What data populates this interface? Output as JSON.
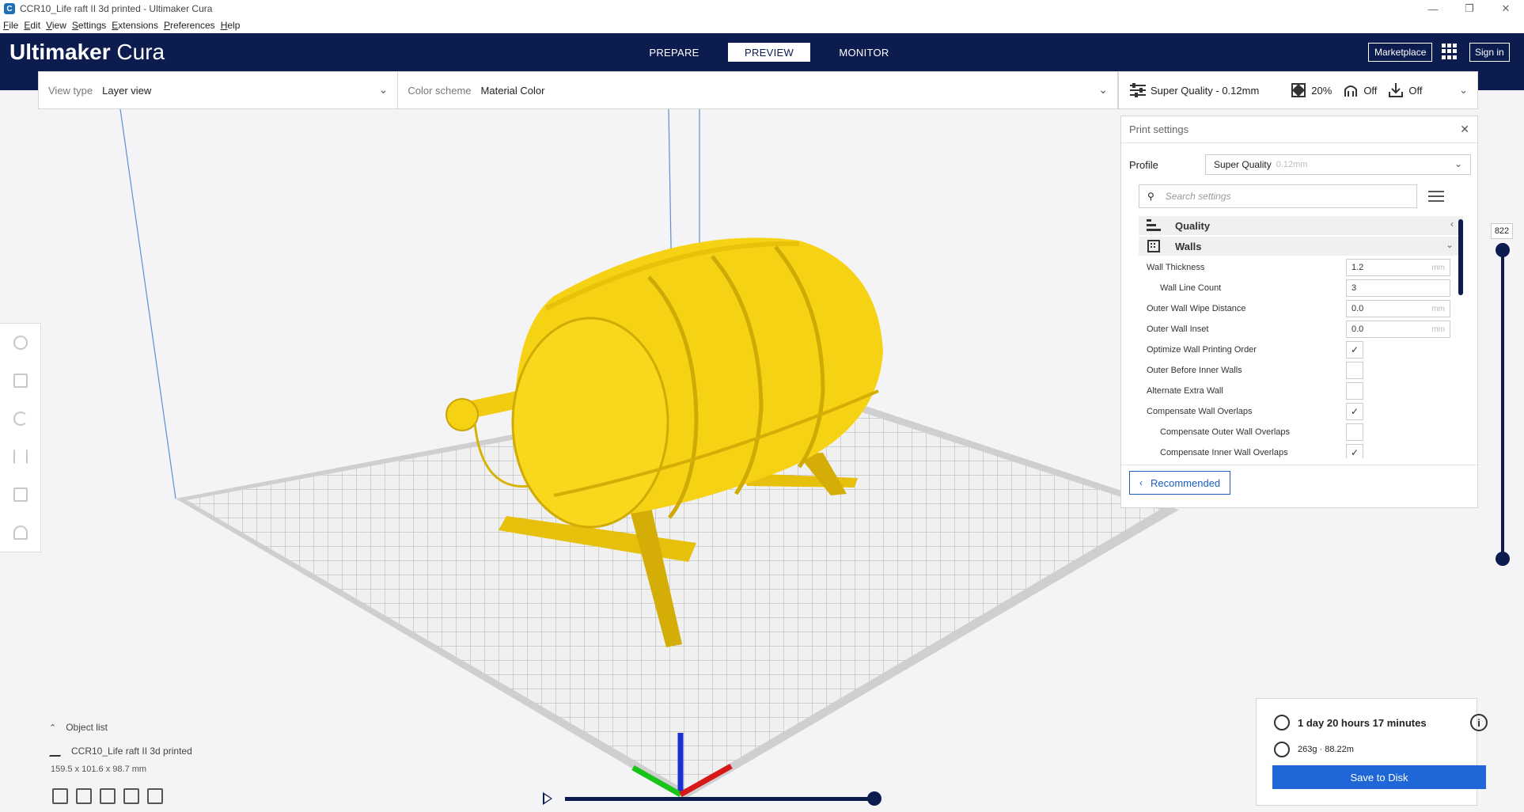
{
  "window": {
    "title": "CCR10_Life raft II 3d printed - Ultimaker Cura",
    "app_icon": "C"
  },
  "menu": [
    "File",
    "Edit",
    "View",
    "Settings",
    "Extensions",
    "Preferences",
    "Help"
  ],
  "header": {
    "logo_bold": "Ultimaker",
    "logo_light": " Cura",
    "tabs": [
      {
        "label": "PREPARE",
        "active": false
      },
      {
        "label": "PREVIEW",
        "active": true
      },
      {
        "label": "MONITOR",
        "active": false
      }
    ],
    "marketplace": "Marketplace",
    "sign_in": "Sign in"
  },
  "viewbar": {
    "view_type_label": "View type",
    "view_type_value": "Layer view",
    "color_scheme_label": "Color scheme",
    "color_scheme_value": "Material Color"
  },
  "quality_bar": {
    "profile": "Super Quality - 0.12mm",
    "infill": "20%",
    "support": "Off",
    "adhesion": "Off"
  },
  "print_settings": {
    "title": "Print settings",
    "profile_label": "Profile",
    "profile_value": "Super Quality",
    "profile_layer": "0.12mm",
    "search_placeholder": "Search settings",
    "categories": [
      {
        "label": "Quality",
        "icon": "quality-icon"
      },
      {
        "label": "Walls",
        "icon": "walls-icon"
      }
    ],
    "settings": [
      {
        "name": "Wall Thickness",
        "value": "1.2",
        "unit": "mm",
        "type": "input",
        "indent": false
      },
      {
        "name": "Wall Line Count",
        "value": "3",
        "unit": "",
        "type": "input",
        "indent": true
      },
      {
        "name": "Outer Wall Wipe Distance",
        "value": "0.0",
        "unit": "mm",
        "type": "input",
        "indent": false
      },
      {
        "name": "Outer Wall Inset",
        "value": "0.0",
        "unit": "mm",
        "type": "input",
        "indent": false
      },
      {
        "name": "Optimize Wall Printing Order",
        "value": "✓",
        "type": "check",
        "indent": false
      },
      {
        "name": "Outer Before Inner Walls",
        "value": "",
        "type": "check",
        "indent": false
      },
      {
        "name": "Alternate Extra Wall",
        "value": "",
        "type": "check",
        "indent": false
      },
      {
        "name": "Compensate Wall Overlaps",
        "value": "✓",
        "type": "check",
        "indent": false
      },
      {
        "name": "Compensate Outer Wall Overlaps",
        "value": "",
        "type": "check",
        "indent": true
      },
      {
        "name": "Compensate Inner Wall Overlaps",
        "value": "✓",
        "type": "check",
        "indent": true
      }
    ],
    "recommended_label": "Recommended"
  },
  "layer_slider": {
    "value": "822"
  },
  "object_list": {
    "title": "Object list",
    "object_name": "CCR10_Life raft II 3d printed",
    "dimensions": "159.5 x 101.6 x 98.7 mm"
  },
  "output": {
    "print_time": "1 day 20 hours 17 minutes",
    "material": "263g · 88.22m",
    "save_label": "Save to Disk"
  },
  "colors": {
    "header_bg": "#0d1c4f",
    "accent": "#1f67d8",
    "model": "#f5d214"
  }
}
